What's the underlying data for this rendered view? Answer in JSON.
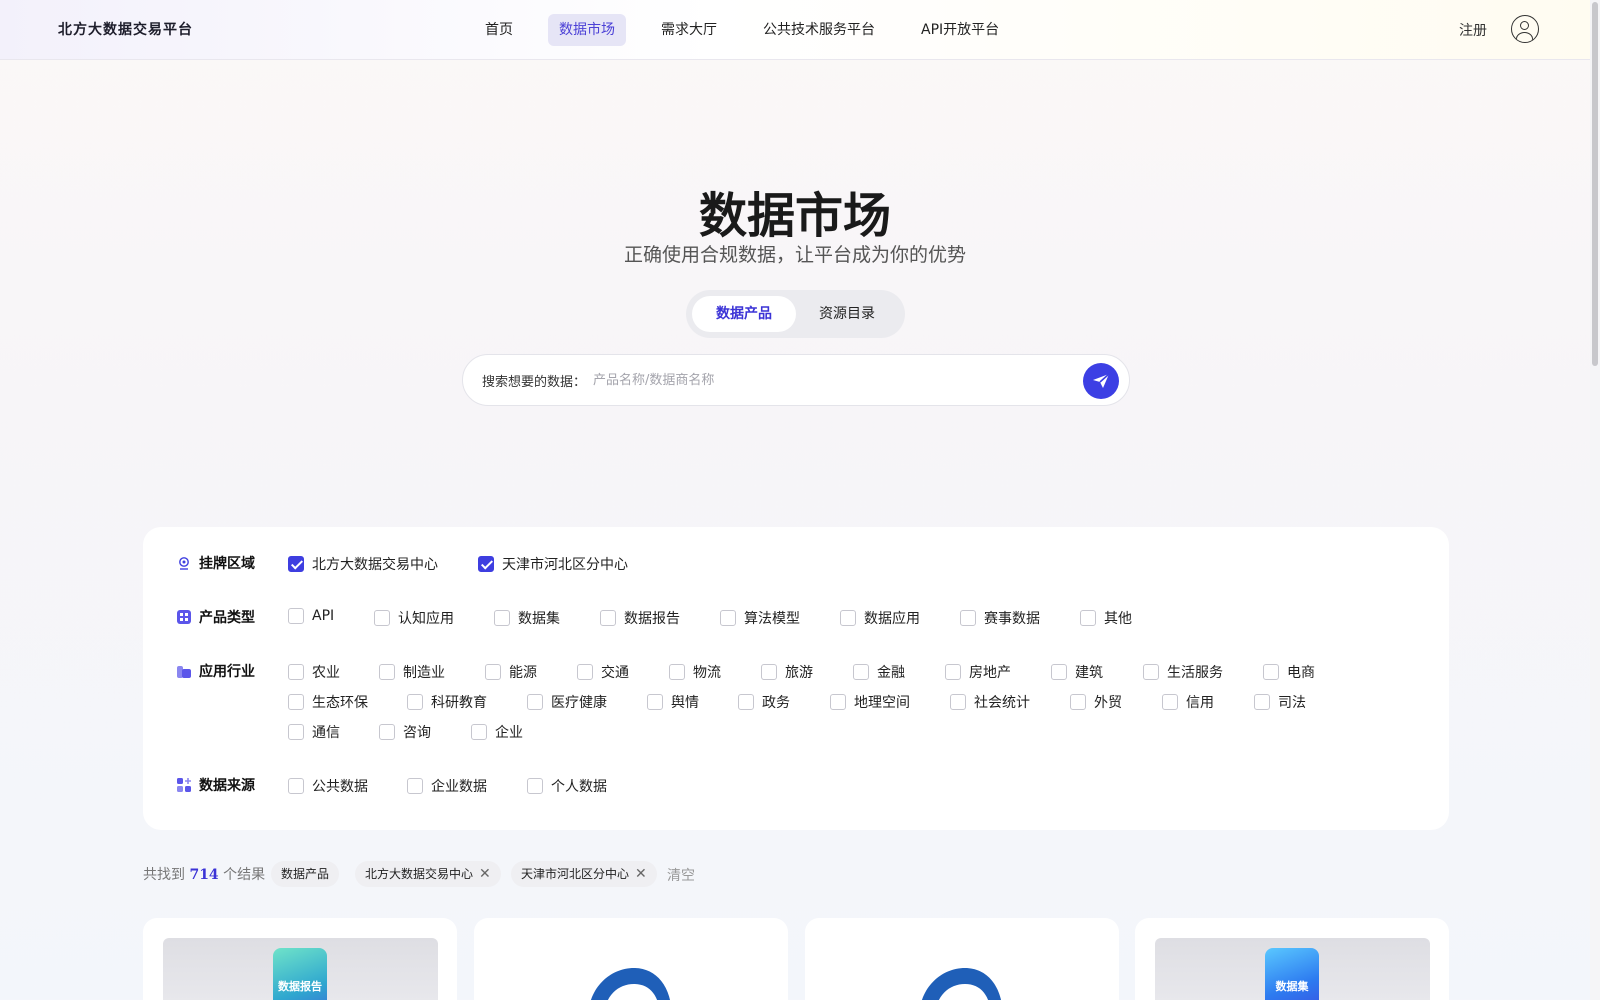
{
  "header": {
    "logo": "北方大数据交易平台",
    "nav": [
      {
        "label": "首页",
        "active": false
      },
      {
        "label": "数据市场",
        "active": true
      },
      {
        "label": "需求大厅",
        "active": false
      },
      {
        "label": "公共技术服务平台",
        "active": false
      },
      {
        "label": "API开放平台",
        "active": false
      }
    ],
    "register": "注册",
    "avatar_icon": "user-icon"
  },
  "hero": {
    "title": "数据市场",
    "subtitle": "正确使用合规数据，让平台成为你的优势",
    "tabs": [
      {
        "label": "数据产品",
        "active": true
      },
      {
        "label": "资源目录",
        "active": false
      }
    ],
    "search_label": "搜索想要的数据：",
    "search_placeholder": "产品名称/数据商名称",
    "search_icon": "send-icon"
  },
  "filters": {
    "region": {
      "label": "挂牌区域",
      "icon": "location-icon",
      "options": [
        {
          "label": "北方大数据交易中心",
          "checked": true
        },
        {
          "label": "天津市河北区分中心",
          "checked": true
        }
      ]
    },
    "product_type": {
      "label": "产品类型",
      "icon": "grid-icon",
      "options": [
        {
          "label": "API",
          "checked": false
        },
        {
          "label": "认知应用",
          "checked": false
        },
        {
          "label": "数据集",
          "checked": false
        },
        {
          "label": "数据报告",
          "checked": false
        },
        {
          "label": "算法模型",
          "checked": false
        },
        {
          "label": "数据应用",
          "checked": false
        },
        {
          "label": "赛事数据",
          "checked": false
        },
        {
          "label": "其他",
          "checked": false
        }
      ]
    },
    "industry": {
      "label": "应用行业",
      "icon": "industry-icon",
      "options": [
        {
          "label": "农业",
          "checked": false
        },
        {
          "label": "制造业",
          "checked": false
        },
        {
          "label": "能源",
          "checked": false
        },
        {
          "label": "交通",
          "checked": false
        },
        {
          "label": "物流",
          "checked": false
        },
        {
          "label": "旅游",
          "checked": false
        },
        {
          "label": "金融",
          "checked": false
        },
        {
          "label": "房地产",
          "checked": false
        },
        {
          "label": "建筑",
          "checked": false
        },
        {
          "label": "生活服务",
          "checked": false
        },
        {
          "label": "电商",
          "checked": false
        },
        {
          "label": "生态环保",
          "checked": false
        },
        {
          "label": "科研教育",
          "checked": false
        },
        {
          "label": "医疗健康",
          "checked": false
        },
        {
          "label": "舆情",
          "checked": false
        },
        {
          "label": "政务",
          "checked": false
        },
        {
          "label": "地理空间",
          "checked": false
        },
        {
          "label": "社会统计",
          "checked": false
        },
        {
          "label": "外贸",
          "checked": false
        },
        {
          "label": "信用",
          "checked": false
        },
        {
          "label": "司法",
          "checked": false
        },
        {
          "label": "通信",
          "checked": false
        },
        {
          "label": "咨询",
          "checked": false
        },
        {
          "label": "企业",
          "checked": false
        }
      ]
    },
    "source": {
      "label": "数据来源",
      "icon": "apps-icon",
      "options": [
        {
          "label": "公共数据",
          "checked": false
        },
        {
          "label": "企业数据",
          "checked": false
        },
        {
          "label": "个人数据",
          "checked": false
        }
      ]
    }
  },
  "results": {
    "prefix": "共找到",
    "count": "714",
    "suffix": "个结果",
    "tags": [
      {
        "label": "数据产品",
        "removable": false
      },
      {
        "label": "北方大数据交易中心",
        "removable": true
      },
      {
        "label": "天津市河北区分中心",
        "removable": true
      }
    ],
    "clear": "清空",
    "close_icon": "close-icon"
  },
  "cards": [
    {
      "badge": "数据报告",
      "icon": "report-cube-icon"
    },
    {
      "badge": "",
      "icon": "cloud-logo-icon"
    },
    {
      "badge": "",
      "icon": "cloud-logo-icon"
    },
    {
      "badge": "数据集",
      "icon": "dataset-cube-icon"
    }
  ],
  "colors": {
    "accent": "#3c3fe4",
    "active_nav_bg": "#e6e5f6",
    "active_text": "#3b33d6"
  }
}
